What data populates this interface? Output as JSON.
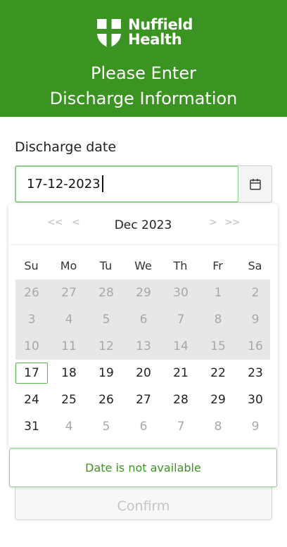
{
  "header": {
    "brand_line1": "Nuffield",
    "brand_line2": "Health",
    "title_line1": "Please Enter",
    "title_line2": "Discharge Information"
  },
  "form": {
    "discharge_label": "Discharge date",
    "discharge_value": "17-12-2023",
    "calendar_icon": "calendar-icon"
  },
  "datepicker": {
    "prev_year": "<<",
    "prev_month": "<",
    "month_label": "Dec 2023",
    "next_month": ">",
    "next_year": ">>",
    "weekdays": [
      "Su",
      "Mo",
      "Tu",
      "We",
      "Th",
      "Fr",
      "Sa"
    ],
    "weeks": [
      [
        "26",
        "27",
        "28",
        "29",
        "30",
        "1",
        "2"
      ],
      [
        "3",
        "4",
        "5",
        "6",
        "7",
        "8",
        "9"
      ],
      [
        "10",
        "11",
        "12",
        "13",
        "14",
        "15",
        "16"
      ],
      [
        "17",
        "18",
        "19",
        "20",
        "21",
        "22",
        "23"
      ],
      [
        "24",
        "25",
        "26",
        "27",
        "28",
        "29",
        "30"
      ],
      [
        "31",
        "4",
        "5",
        "6",
        "7",
        "8",
        "9"
      ]
    ],
    "selected": "17"
  },
  "alert": {
    "message": "Date is not available"
  },
  "actions": {
    "confirm_label": "Confirm"
  },
  "colors": {
    "brand_green": "#3b9422",
    "input_border": "#8fd08a",
    "disabled_week_bg": "#e7e7e7"
  }
}
